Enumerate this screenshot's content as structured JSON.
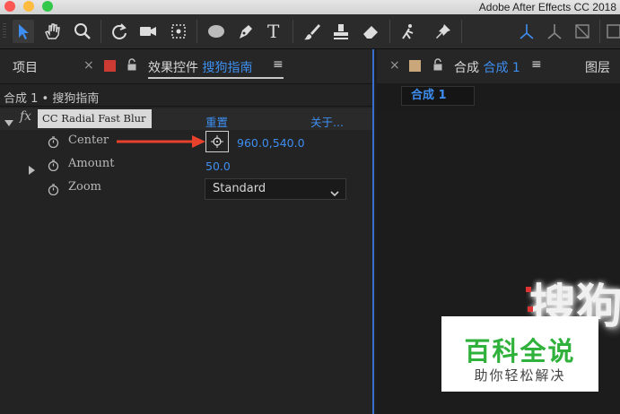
{
  "app": {
    "title": "Adobe After Effects CC 2018"
  },
  "left_panel": {
    "tab_project": "项目",
    "tab_close": "×",
    "tab_effects_label": "效果控件",
    "tab_effects_layer": "搜狗指南",
    "menu": "≡",
    "breadcrumb": "合成 1 • 搜狗指南",
    "effect": {
      "fx": "fx",
      "name": "CC Radial Fast Blur",
      "reset": "重置",
      "about": "关于..."
    },
    "properties": [
      {
        "name": "Center",
        "value": "960.0,540.0"
      },
      {
        "name": "Amount",
        "value": "50.0"
      },
      {
        "name": "Zoom",
        "value": "Standard"
      }
    ]
  },
  "right_panel": {
    "tab_close": "×",
    "tab_label": "合成",
    "tab_comp": "合成 1",
    "menu": "≡",
    "tab_layer": "图层",
    "comp_tab": "合成 1",
    "viewer_text": "搜狗"
  },
  "watermark": {
    "title": "百科全说",
    "subtitle": "助你轻松解决"
  },
  "colors": {
    "accent": "#3d8ef0",
    "arrow": "#e8412c",
    "panel_focus": "#3a6fd0"
  }
}
